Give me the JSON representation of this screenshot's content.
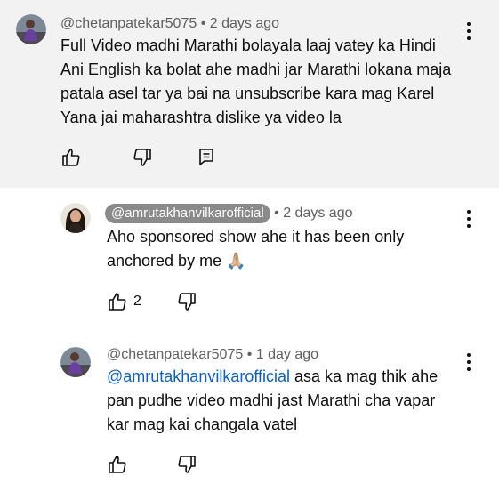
{
  "comments": [
    {
      "handle": "@chetanpatekar5075",
      "separator": "•",
      "time": "2 days ago",
      "text": "Full Video madhi Marathi bolayala laaj vatey ka Hindi Ani English ka bolat ahe madhi jar Marathi lokana maja patala asel tar ya bai na unsubscribe kara mag Karel Yana jai maharashtra dislike ya video la"
    },
    {
      "handle": "@amrutakhanvilkarofficial",
      "separator": "•",
      "time": "2 days ago",
      "text": "Aho sponsored show ahe it has been only anchored by me",
      "emoji": "🙏🏼",
      "likes": "2"
    },
    {
      "handle": "@chetanpatekar5075",
      "separator": "•",
      "time": "1 day ago",
      "mention": "@amrutakhanvilkarofficial",
      "text": " asa ka mag thik ahe pan pudhe video madhi jast Marathi cha vapar kar mag kai changala vatel"
    }
  ],
  "icons": {
    "like": "thumbs-up-icon",
    "dislike": "thumbs-down-icon",
    "reply": "reply-icon",
    "more": "more-vert-icon"
  },
  "colors": {
    "highlight_bg": "#f2f2f2",
    "mention": "#065fd4",
    "meta": "#606060",
    "creator_chip": "#8a8a8a"
  }
}
